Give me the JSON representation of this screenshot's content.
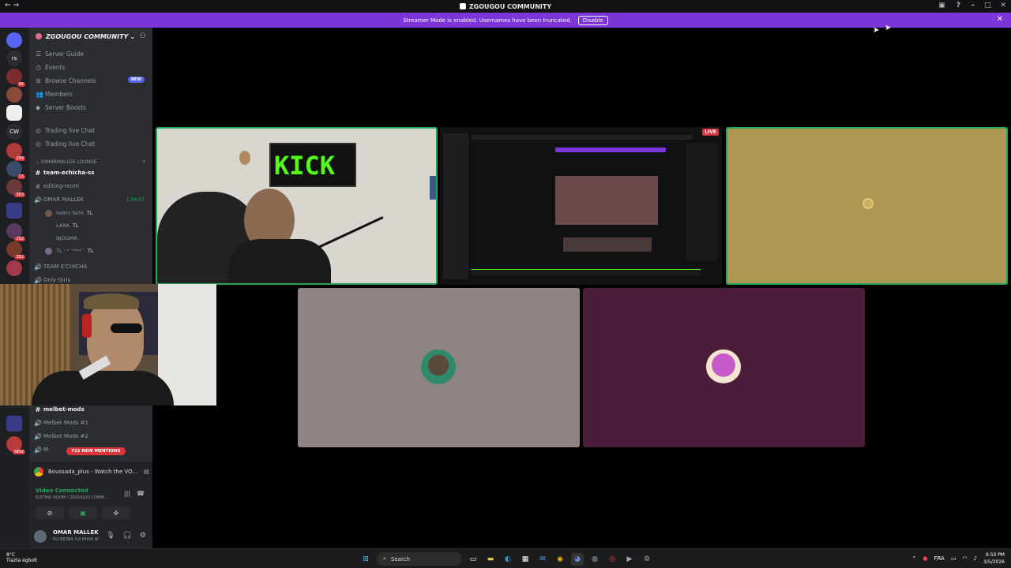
{
  "window": {
    "title": "ZGOUGOU COMMUNITY",
    "left_glyphs": "← →",
    "min": "–",
    "max": "□",
    "close": "✕"
  },
  "banner": {
    "text": "Streamer Mode is enabled. Usernames have been truncated.",
    "disable_label": "Disable"
  },
  "guilds": [
    {
      "label": "",
      "badge": ""
    },
    {
      "label": "rs",
      "badge": ""
    },
    {
      "label": "",
      "badge": "66"
    },
    {
      "label": "",
      "badge": ""
    },
    {
      "label": "",
      "badge": ""
    },
    {
      "label": "CW",
      "badge": ""
    },
    {
      "label": "",
      "badge": "299"
    },
    {
      "label": "",
      "badge": "13"
    },
    {
      "label": "",
      "badge": "363"
    },
    {
      "label": "",
      "badge": ""
    },
    {
      "label": "",
      "badge": "292"
    },
    {
      "label": "",
      "badge": "382"
    },
    {
      "label": "",
      "badge": ""
    }
  ],
  "server": {
    "name": "ZGOUGOU COMMUNITY",
    "nav": [
      {
        "icon": "☰",
        "label": "Server Guide"
      },
      {
        "icon": "◷",
        "label": "Events"
      },
      {
        "icon": "⊞",
        "label": "Browse Channels",
        "badge": "NEW"
      },
      {
        "icon": "👥",
        "label": "Members"
      },
      {
        "icon": "◆",
        "label": "Server Boosts"
      }
    ],
    "trading": [
      "Trading live Chat",
      "Trading live Chat"
    ],
    "category": "IOMARMALLEK LOUNGE",
    "channels": {
      "team_echicha": "team-echicha-ss",
      "editing_room": "editing-room",
      "omar_mallek": "OMAR MALLEK",
      "omar_time": "1:04:07",
      "team_echicha_voice": "TEAM E'CHICHA",
      "only_girls": "Only Girls",
      "melbet_mods": "melbet-mods",
      "melbet_1": "Melbet Mods #1",
      "melbet_2": "Melbet Mods #2",
      "melbet_3": "M"
    },
    "voice_users": [
      {
        "name": "helmi ferhi",
        "tag": "TL"
      },
      {
        "name": "LARA",
        "tag": "TL"
      },
      {
        "name": "NJOUMA",
        "tag": ""
      },
      {
        "name": "TL · ᵒ˙ᵏⁱᵗᵗʸᵒ˙",
        "tag": "TL"
      }
    ],
    "mentions": "722 NEW MENTIONS"
  },
  "activity": {
    "text": "Boussada_plus - Watch the VO..."
  },
  "voice": {
    "status": "Video Connected",
    "location": "EDITING ROOM / ZGOUGOU COMM..."
  },
  "user": {
    "name": "OMAR MALLEK",
    "status": "ELI BE3NA Y;II NHAR W"
  },
  "stage": {
    "live": "LIVE",
    "kick_sign": "KICK"
  },
  "taskbar": {
    "temp": "8°C",
    "weather": "Tlazta égbolt",
    "search": "Search",
    "lang": "FRA",
    "time": "9:50 PM",
    "date": "3/5/2026"
  },
  "colors": {
    "banner": "#7b35d9",
    "speaking": "#23a55a",
    "mention": "#da373c",
    "tile_gray": "#8e8483",
    "tile_plum": "#4c1d3a",
    "tile_olive": "#ad9752"
  }
}
